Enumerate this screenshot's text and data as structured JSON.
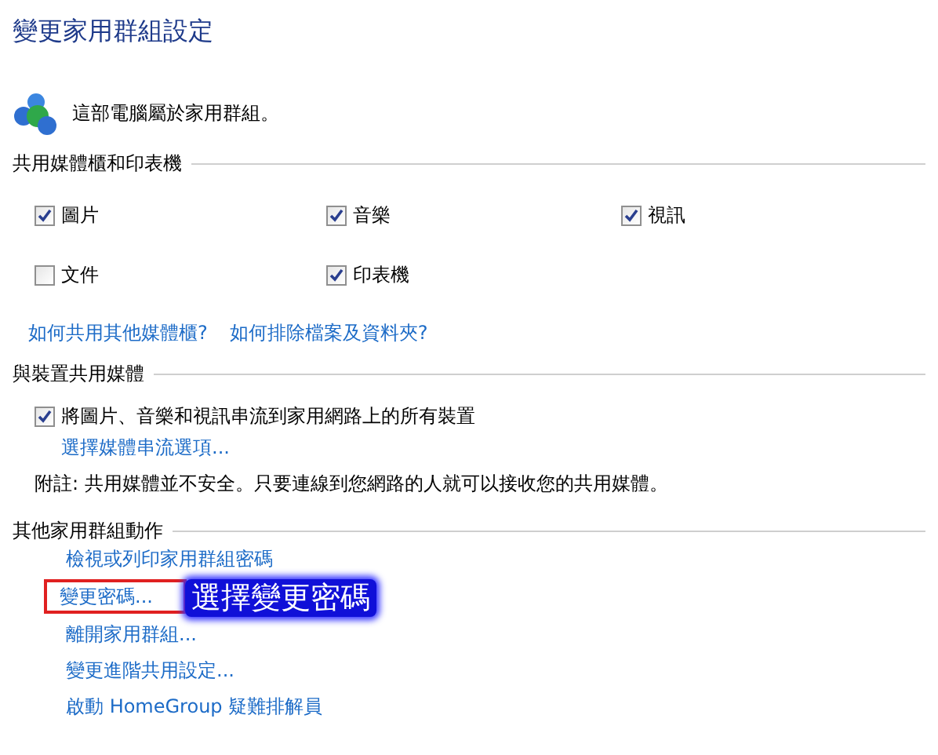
{
  "title": "變更家用群組設定",
  "status": {
    "text": "這部電腦屬於家用群組。"
  },
  "media_sharing": {
    "heading": "共用媒體櫃和印表機",
    "items": [
      {
        "label": "圖片",
        "checked": true
      },
      {
        "label": "音樂",
        "checked": true
      },
      {
        "label": "視訊",
        "checked": true
      },
      {
        "label": "文件",
        "checked": false
      },
      {
        "label": "印表機",
        "checked": true
      }
    ],
    "links": [
      "如何共用其他媒體櫃?",
      "如何排除檔案及資料夾?"
    ]
  },
  "devices": {
    "heading": "與裝置共用媒體",
    "stream": {
      "label": "將圖片、音樂和視訊串流到家用網路上的所有裝置",
      "checked": true
    },
    "link": "選擇媒體串流選項...",
    "note": "附註: 共用媒體並不安全。只要連線到您網路的人就可以接收您的共用媒體。"
  },
  "actions": {
    "heading": "其他家用群組動作",
    "links": [
      {
        "label": "檢視或列印家用群組密碼",
        "highlighted": false
      },
      {
        "label": "變更密碼...",
        "highlighted": true
      },
      {
        "label": "離開家用群組...",
        "highlighted": false
      },
      {
        "label": "變更進階共用設定...",
        "highlighted": false
      },
      {
        "label": "啟動 HomeGroup 疑難排解員",
        "highlighted": false
      }
    ]
  },
  "callout": {
    "text": "選擇變更密碼"
  }
}
